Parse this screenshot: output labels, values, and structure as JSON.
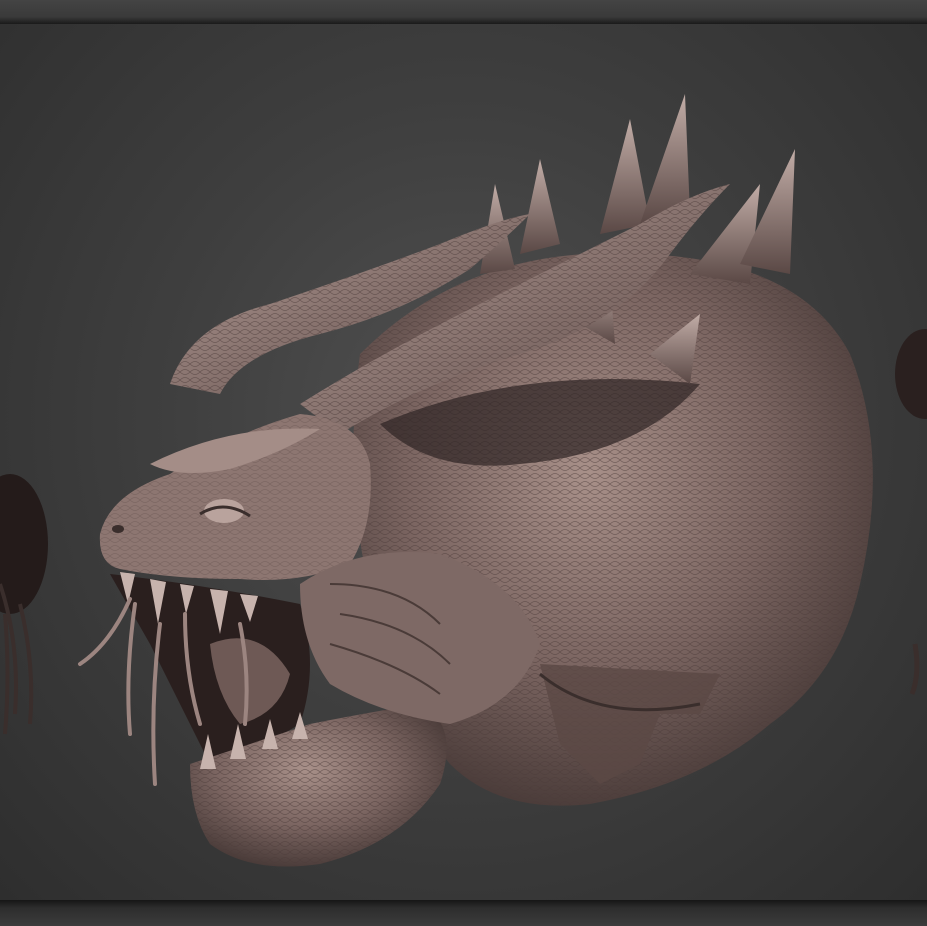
{
  "scene": {
    "subject": "dragon-head-sculpt",
    "colors": {
      "background": "#3f3f3f",
      "frame": "#1b1b1b",
      "clay": "#8a7470",
      "clay_shadow": "#3a2e2c",
      "clay_highlight": "#b59f99"
    }
  }
}
